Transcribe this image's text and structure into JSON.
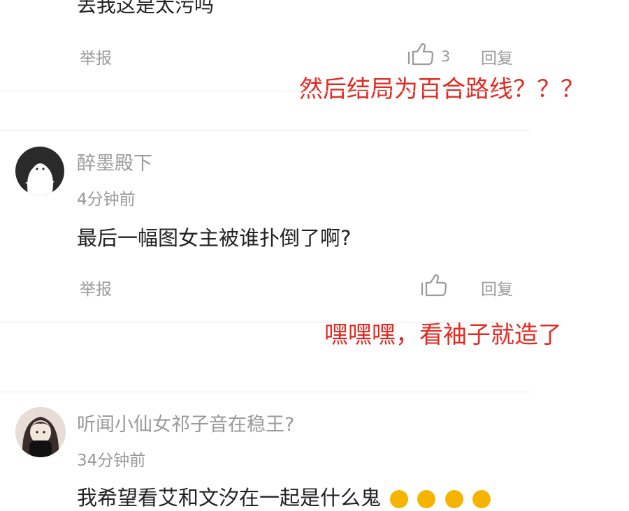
{
  "comments": [
    {
      "text": "丢我这是太污吗",
      "report_label": "举报",
      "like_count": "3",
      "reply_label": "回复"
    },
    {
      "username": "醉墨殿下",
      "time": "4分钟前",
      "text": "最后一幅图女主被谁扑倒了啊?",
      "report_label": "举报",
      "reply_label": "回复"
    },
    {
      "username": "听闻小仙女祁子音在稳王?",
      "time": "34分钟前",
      "text": "我希望看艾和文汐在一起是什么鬼"
    }
  ],
  "annotations": [
    "然后结局为百合路线？？？",
    "嘿嘿嘿，看袖子就造了"
  ],
  "colors": {
    "annotation": "#e32a22",
    "muted_text": "#9a9a9a",
    "body_text": "#222222"
  },
  "icons": [
    "thumbs-up-icon",
    "avatar-ghost-icon",
    "avatar-photo-icon",
    "emoji-icon"
  ]
}
